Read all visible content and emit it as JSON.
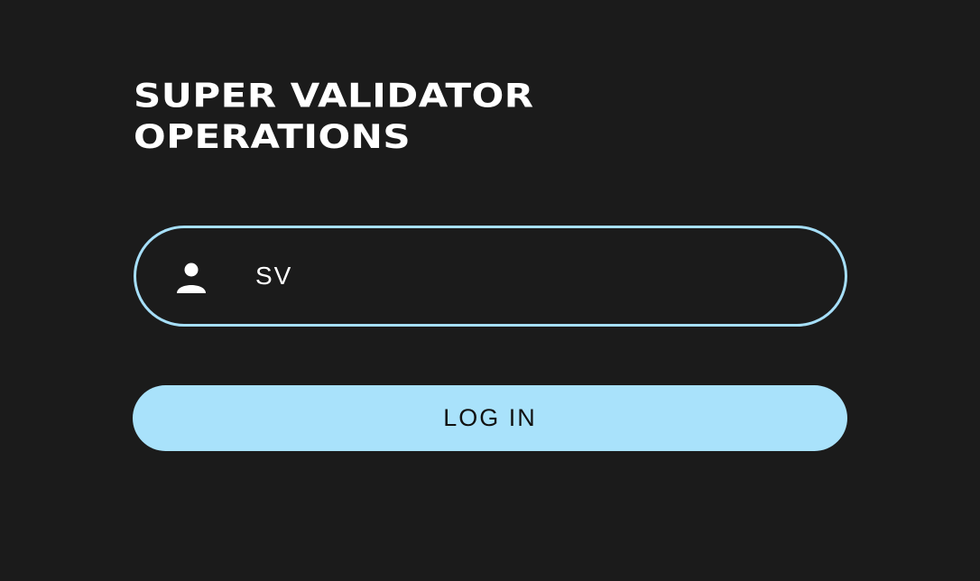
{
  "page": {
    "title_line1": "SUPER VALIDATOR",
    "title_line2": "OPERATIONS"
  },
  "login_form": {
    "user_icon": "user-icon",
    "username_value": "SV",
    "login_label": "LOG IN"
  },
  "colors": {
    "background": "#1b1b1b",
    "accent": "#a9e2fb",
    "text": "#ffffff"
  }
}
